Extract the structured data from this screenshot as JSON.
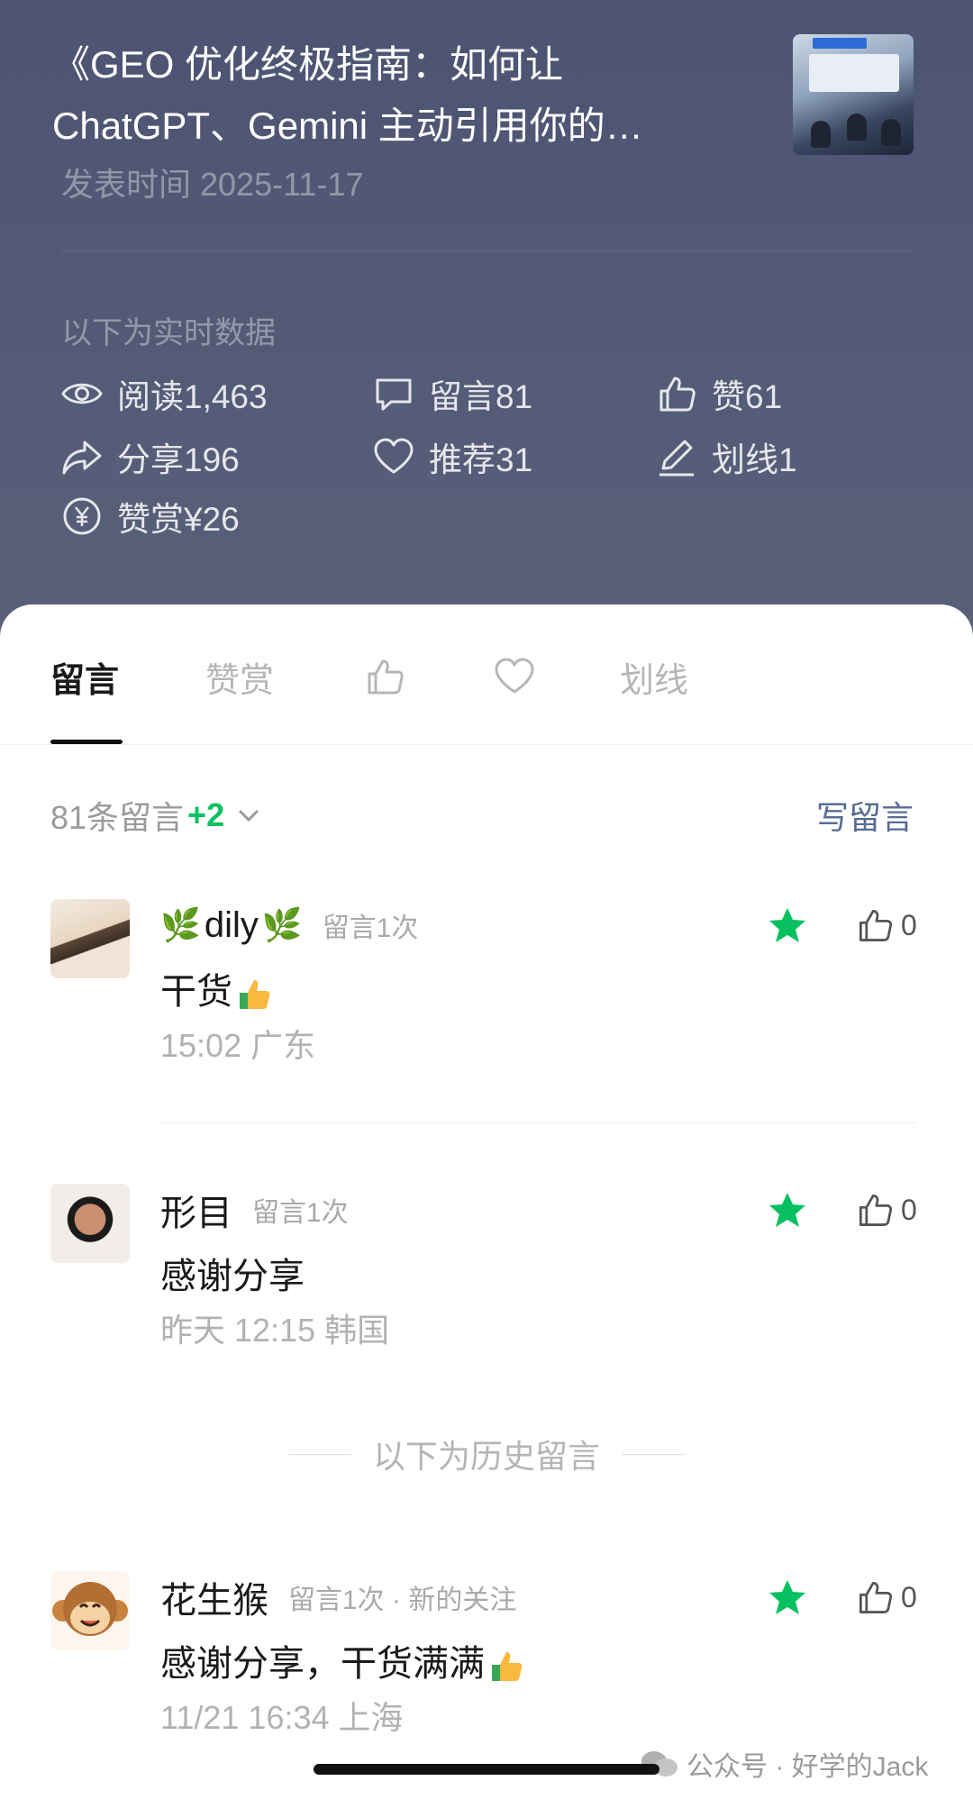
{
  "header": {
    "title": "《GEO 优化终极指南：如何让ChatGPT、Gemini 主动引用你的…",
    "publish_time": "发表时间 2025-11-17",
    "realtime_label": "以下为实时数据",
    "stats": {
      "read": "阅读1,463",
      "comments": "留言81",
      "likes": "赞61",
      "shares": "分享196",
      "recommend": "推荐31",
      "underline": "划线1",
      "reward": "赞赏¥26"
    },
    "thumbnail_icon": "conference-photo"
  },
  "tabs": {
    "comments": "留言",
    "reward": "赞赏",
    "like_icon": "thumbs-up-icon",
    "heart_icon": "heart-icon",
    "underline": "划线"
  },
  "comments_header": {
    "count": "81条留言",
    "new": "+2",
    "write": "写留言"
  },
  "comments": [
    {
      "name": "dily",
      "meta": "留言1次",
      "text": "干货",
      "time": "15:02  广东",
      "likes": "0"
    },
    {
      "name": "形目",
      "meta": "留言1次",
      "text": "感谢分享",
      "time": "昨天 12:15  韩国",
      "likes": "0"
    },
    {
      "name": "花生猴",
      "meta": "留言1次 · 新的关注",
      "text": "感谢分享，干货满满",
      "time": "11/21 16:34  上海",
      "likes": "0"
    }
  ],
  "history_label": "以下为历史留言",
  "watermark": "公众号 · 好学的Jack",
  "colors": {
    "accent_green": "#07c160",
    "link_blue": "#576b95",
    "header_bg": "#4f5672"
  }
}
